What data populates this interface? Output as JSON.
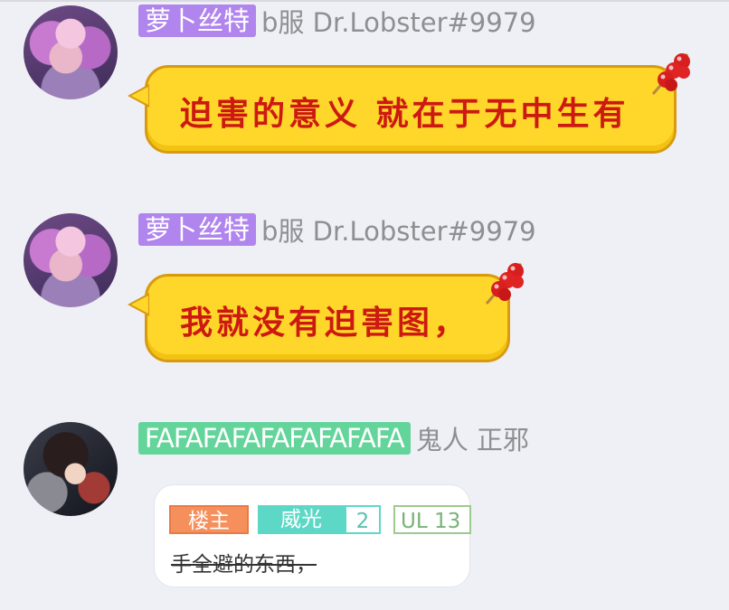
{
  "messages": [
    {
      "badge": "萝卜丝特",
      "badge_color": "#b085ee",
      "nickname": "b服 Dr.Lobster#9979",
      "bubble_text": "迫害的意义 就在于无中生有",
      "bubble_style": "candy-yellow",
      "bubble_text_color": "#cc1a12"
    },
    {
      "badge": "萝卜丝特",
      "badge_color": "#b085ee",
      "nickname": "b服 Dr.Lobster#9979",
      "bubble_text": "我就没有迫害图，",
      "bubble_style": "candy-yellow",
      "bubble_text_color": "#cc1a12"
    },
    {
      "badge": "FAFAFAFAFAFAFAFAFA",
      "badge_color": "#63d59b",
      "nickname": "鬼人 正邪",
      "card": {
        "tag_host": "楼主",
        "tag_title": "威光",
        "tag_level": "2",
        "tag_ul": "UL 13",
        "text": "手全避的东西，"
      }
    }
  ],
  "icons": [
    "candied-haws-icon"
  ]
}
